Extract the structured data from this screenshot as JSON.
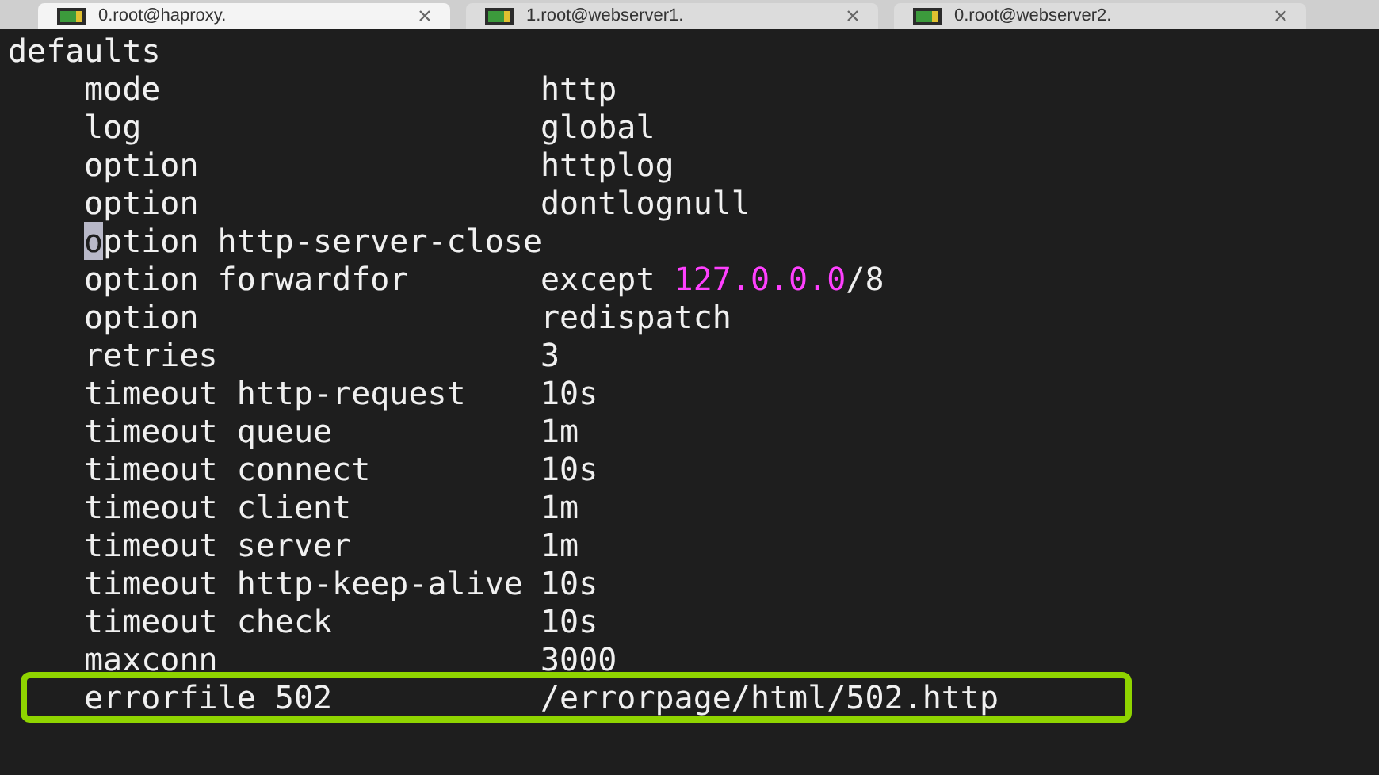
{
  "tabs": [
    {
      "label": "0.root@haproxy.",
      "selected": true
    },
    {
      "label": "1.root@webserver1.",
      "selected": false
    },
    {
      "label": "0.root@webserver2.",
      "selected": false
    }
  ],
  "terminal": {
    "lines": [
      {
        "kind": "section",
        "key": "defaults",
        "cursor": false,
        "highlighted": false
      },
      {
        "kind": "entry",
        "key": "mode",
        "cursor": false,
        "highlighted": false,
        "segments": [
          {
            "text": "http",
            "kind": "plain"
          }
        ]
      },
      {
        "kind": "entry",
        "key": "log",
        "cursor": false,
        "highlighted": false,
        "segments": [
          {
            "text": "global",
            "kind": "plain"
          }
        ]
      },
      {
        "kind": "entry",
        "key": "option",
        "cursor": false,
        "highlighted": false,
        "segments": [
          {
            "text": "httplog",
            "kind": "plain"
          }
        ]
      },
      {
        "kind": "entry",
        "key": "option",
        "cursor": false,
        "highlighted": false,
        "segments": [
          {
            "text": "dontlognull",
            "kind": "plain"
          }
        ]
      },
      {
        "kind": "entry",
        "key": "option http-server-close",
        "cursor": true,
        "highlighted": false
      },
      {
        "kind": "entry",
        "key": "option forwardfor",
        "cursor": false,
        "highlighted": false,
        "segments": [
          {
            "text": "except ",
            "kind": "plain"
          },
          {
            "text": "127.0.0.0",
            "kind": "number"
          },
          {
            "text": "/8",
            "kind": "plain"
          }
        ]
      },
      {
        "kind": "entry",
        "key": "option",
        "cursor": false,
        "highlighted": false,
        "segments": [
          {
            "text": "redispatch",
            "kind": "plain"
          }
        ]
      },
      {
        "kind": "entry",
        "key": "retries",
        "cursor": false,
        "highlighted": false,
        "segments": [
          {
            "text": "3",
            "kind": "plain"
          }
        ]
      },
      {
        "kind": "entry",
        "key": "timeout http-request",
        "cursor": false,
        "highlighted": false,
        "segments": [
          {
            "text": "10s",
            "kind": "plain"
          }
        ]
      },
      {
        "kind": "entry",
        "key": "timeout queue",
        "cursor": false,
        "highlighted": false,
        "segments": [
          {
            "text": "1m",
            "kind": "plain"
          }
        ]
      },
      {
        "kind": "entry",
        "key": "timeout connect",
        "cursor": false,
        "highlighted": false,
        "segments": [
          {
            "text": "10s",
            "kind": "plain"
          }
        ]
      },
      {
        "kind": "entry",
        "key": "timeout client",
        "cursor": false,
        "highlighted": false,
        "segments": [
          {
            "text": "1m",
            "kind": "plain"
          }
        ]
      },
      {
        "kind": "entry",
        "key": "timeout server",
        "cursor": false,
        "highlighted": false,
        "segments": [
          {
            "text": "1m",
            "kind": "plain"
          }
        ]
      },
      {
        "kind": "entry",
        "key": "timeout http-keep-alive",
        "cursor": false,
        "highlighted": false,
        "segments": [
          {
            "text": "10s",
            "kind": "plain"
          }
        ]
      },
      {
        "kind": "entry",
        "key": "timeout check",
        "cursor": false,
        "highlighted": false,
        "segments": [
          {
            "text": "10s",
            "kind": "plain"
          }
        ]
      },
      {
        "kind": "entry",
        "key": "maxconn",
        "cursor": false,
        "highlighted": false,
        "segments": [
          {
            "text": "3000",
            "kind": "plain"
          }
        ]
      },
      {
        "kind": "entry",
        "key": "errorfile 502",
        "cursor": false,
        "highlighted": true,
        "segments": [
          {
            "text": "/errorpage/html/502.http",
            "kind": "plain"
          }
        ]
      }
    ]
  }
}
